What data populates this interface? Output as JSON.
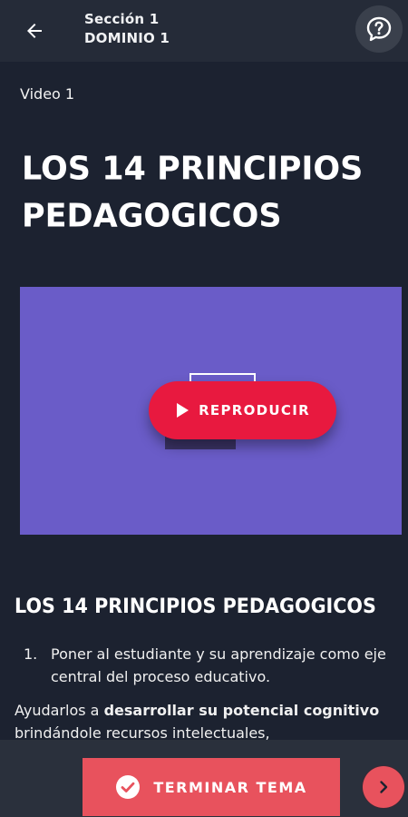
{
  "header": {
    "section": "Sección 1",
    "domain": "DOMINIO 1",
    "back_icon": "arrow-left-icon",
    "help_icon": "question-chat-icon"
  },
  "content": {
    "video_label": "Video 1",
    "title_line1": "LOS 14 PRINCIPIOS",
    "title_line2": "PEDAGOGICOS",
    "play_label": "REPRODUCIR",
    "section_title": "LOS 14 PRINCIPIOS PEDAGOGICOS",
    "list_number": "1.",
    "list_text": "Poner al estudiante y su aprendizaje como eje central del proceso educativo.",
    "paragraph_pre": "Ayudarlos a ",
    "paragraph_bold": "desarrollar su potencial cognitivo",
    "paragraph_post": " brindándole recursos intelectuales,"
  },
  "footer": {
    "finish_label": "TERMINAR TEMA",
    "finish_icon": "check-circle-icon",
    "next_icon": "chevron-right-icon"
  },
  "colors": {
    "background": "#1c2230",
    "header": "#252b38",
    "video": "#6a5cc8",
    "play": "#e8193f",
    "finish": "#e8525d"
  }
}
